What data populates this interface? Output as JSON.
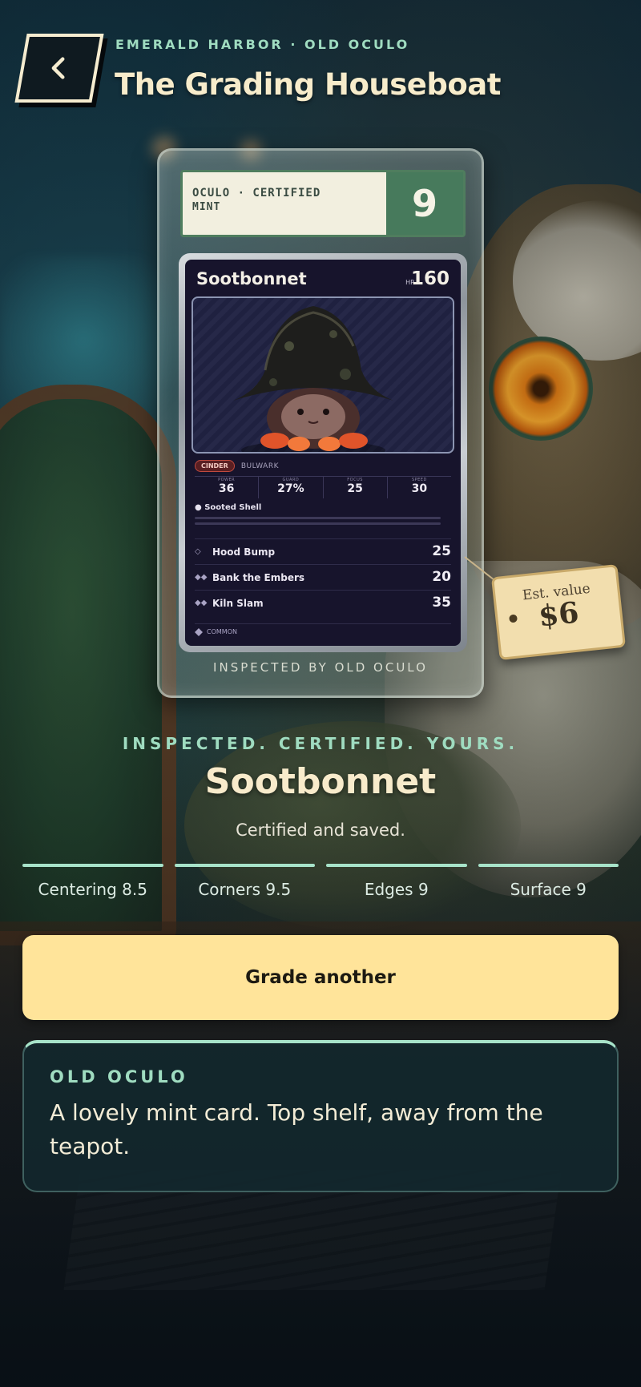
{
  "header": {
    "back_label": "Back",
    "kicker": "EMERALD HARBOR · OLD OCULO",
    "title": "The Grading Houseboat"
  },
  "slab": {
    "certified_label": "OCULO · CERTIFIED",
    "condition_label": "MINT",
    "grade": "9",
    "inspected_by": "INSPECTED BY OLD OCULO"
  },
  "card": {
    "name": "Sootbonnet",
    "hp_label": "HP",
    "hp": "160",
    "element_tag": "CINDER",
    "class_tag": "BULWARK",
    "stats": [
      {
        "label": "POWER",
        "value": "36"
      },
      {
        "label": "GUARD",
        "value": "27%"
      },
      {
        "label": "FOCUS",
        "value": "25"
      },
      {
        "label": "SPEED",
        "value": "30"
      }
    ],
    "ability": {
      "name": "Sooted Shell"
    },
    "moves": [
      {
        "icon": "◇",
        "name": "Hood Bump",
        "damage": "25"
      },
      {
        "icon": "◆◆",
        "name": "Bank the Embers",
        "damage": "20"
      },
      {
        "icon": "◆◆",
        "name": "Kiln Slam",
        "damage": "35"
      }
    ],
    "rarity": "COMMON"
  },
  "price_tag": {
    "label": "Est. value",
    "value": "$6"
  },
  "result": {
    "tagline": "INSPECTED. CERTIFIED. YOURS.",
    "name": "Sootbonnet",
    "subtitle": "Certified and saved."
  },
  "subgrades": [
    {
      "label": "Centering 8.5",
      "value": 8.5
    },
    {
      "label": "Corners 9.5",
      "value": 9.5
    },
    {
      "label": "Edges 9",
      "value": 9
    },
    {
      "label": "Surface 9",
      "value": 9
    }
  ],
  "primary_button": {
    "label": "Grade another"
  },
  "dialogue": {
    "speaker": "OLD OCULO",
    "text": "A lovely mint card. Top shelf, away from the teapot."
  },
  "colors": {
    "accent_mint": "#9fdcc0",
    "button_yellow": "#ffe49a",
    "title_cream": "#f7eccb",
    "grade_green": "#477a5c"
  }
}
